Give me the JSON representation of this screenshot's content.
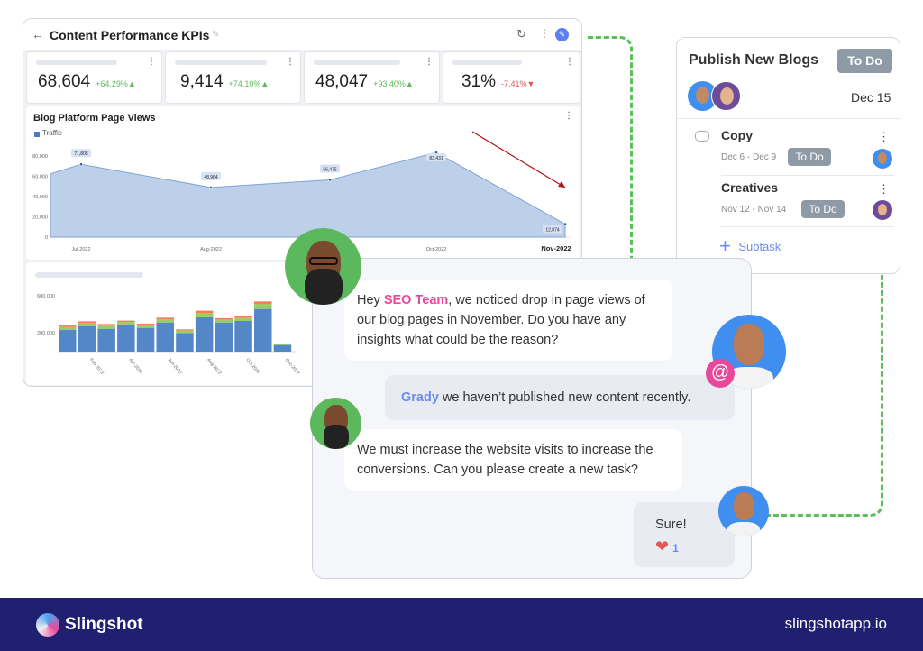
{
  "dashboard": {
    "title": "Content Performance KPIs",
    "kpis": [
      {
        "value": "68,604",
        "change": "+64.29%▲",
        "trend": "up"
      },
      {
        "value": "9,414",
        "change": "+74.10%▲",
        "trend": "up"
      },
      {
        "value": "48,047",
        "change": "+93.40%▲",
        "trend": "up"
      },
      {
        "value": "31%",
        "change": "-7.41%▼",
        "trend": "down"
      }
    ]
  },
  "chart_data": [
    {
      "type": "area",
      "title": "Blog Platform Page Views",
      "legend": [
        "Traffic"
      ],
      "x": [
        "",
        "Jul-2022",
        "Aug-2022",
        "",
        "Oct-2022",
        "Nov-2022"
      ],
      "values": [
        62500,
        71805,
        48964,
        56475,
        83431,
        12874
      ],
      "data_labels": [
        "",
        "71,805",
        "48,964",
        "56,475",
        "83,431",
        "12,874"
      ],
      "ylim": [
        0,
        90000
      ],
      "yticks": [
        "0",
        "20,000",
        "40,000",
        "60,000",
        "80,000"
      ],
      "color": "#bcd0e9",
      "line_color": "#7fa2d6"
    },
    {
      "type": "bar",
      "stacked": true,
      "categories": [
        "Jan-2022",
        "Feb-2022",
        "Mar-2022",
        "Apr-2022",
        "May-2022",
        "Jun-2022",
        "Jul-2022",
        "Aug-2022",
        "Sep-2022",
        "Oct-2022",
        "Nov-2022",
        "Dec-2022"
      ],
      "tick_labels": [
        "",
        "Feb-2022",
        "",
        "Apr-2022",
        "",
        "Jun-2022",
        "",
        "Aug-2022",
        "",
        "Oct-2022",
        "",
        "Dec-2022"
      ],
      "series": [
        {
          "values": [
            232000,
            274000,
            245000,
            281000,
            255000,
            313000,
            200000,
            368000,
            313000,
            329000,
            458000,
            71000
          ],
          "color": "#5387c8"
        },
        {
          "values": [
            32000,
            35000,
            35000,
            36000,
            30000,
            36000,
            26000,
            45000,
            30000,
            35000,
            55000,
            8000
          ],
          "color": "#9ccc65"
        },
        {
          "values": [
            16000,
            16000,
            16000,
            16000,
            16000,
            16000,
            13000,
            26000,
            16000,
            16000,
            26000,
            6000
          ],
          "color": "#f47d5a"
        }
      ],
      "ylim": [
        0,
        620000
      ],
      "yticks": [
        "200,000",
        "600,000"
      ]
    }
  ],
  "task": {
    "title": "Publish New Blogs",
    "status": "To Do",
    "due": "Dec 15",
    "subtasks": [
      {
        "name": "Copy",
        "dates": "Dec 6 - Dec 9",
        "status": "To Do"
      },
      {
        "name": "Creatives",
        "dates": "Nov 12 - Nov 14",
        "status": "To Do"
      }
    ],
    "add_subtask": "Subtask"
  },
  "chat": {
    "m1": {
      "pre": "Hey ",
      "mention": "SEO Team",
      "post": ", we noticed drop in page views of our blog pages in November. Do you have any insights what could be the reason?"
    },
    "m2": {
      "mention": "Grady",
      "post": " we haven’t published new content recently."
    },
    "m3": {
      "text": "We must increase the website visits to increase the conversions. Can you please create a new task?"
    },
    "m4": {
      "text": "Sure!",
      "reaction_count": "1"
    },
    "colors": {
      "mention_pink": "#e8489a",
      "mention_blue": "#6a8cf0"
    }
  },
  "footer": {
    "brand": "Slingshot",
    "url": "slingshotapp.io",
    "bg": "#1f2070"
  }
}
